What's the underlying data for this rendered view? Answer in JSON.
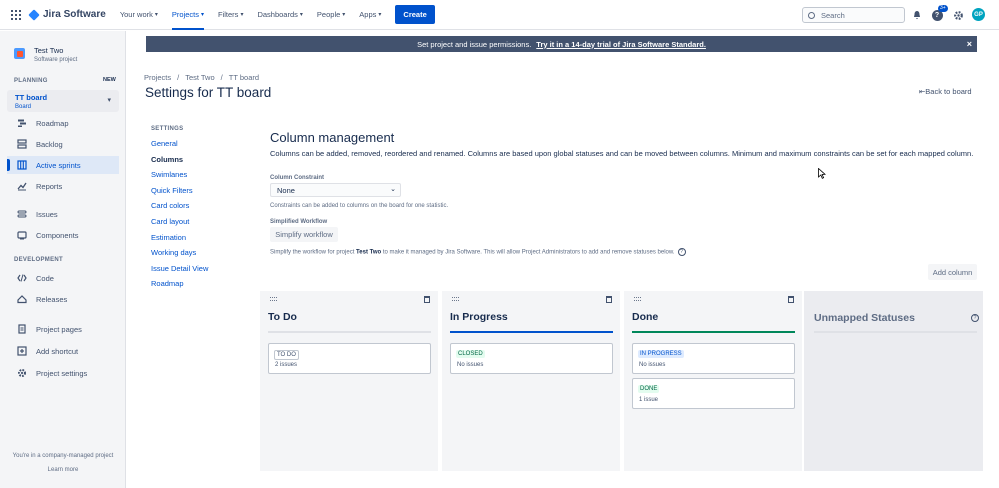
{
  "topnav": {
    "product": "Jira Software",
    "items": [
      {
        "label": "Your work",
        "active": false
      },
      {
        "label": "Projects",
        "active": true
      },
      {
        "label": "Filters",
        "active": false
      },
      {
        "label": "Dashboards",
        "active": false
      },
      {
        "label": "People",
        "active": false
      },
      {
        "label": "Apps",
        "active": false
      }
    ],
    "create": "Create",
    "search_placeholder": "Search",
    "help_badge": "3+",
    "avatar_initials": "GP"
  },
  "sidebar": {
    "project_name": "Test Two",
    "project_type": "Software project",
    "planning_label": "PLANNING",
    "new_badge": "NEW",
    "board_name": "TT board",
    "board_sub": "Board",
    "items": [
      {
        "label": "Roadmap",
        "icon": "roadmap-icon"
      },
      {
        "label": "Backlog",
        "icon": "backlog-icon"
      },
      {
        "label": "Active sprints",
        "icon": "board-icon",
        "active": true
      },
      {
        "label": "Reports",
        "icon": "reports-icon"
      },
      {
        "label": "Issues",
        "icon": "issues-icon"
      },
      {
        "label": "Components",
        "icon": "components-icon"
      }
    ],
    "dev_label": "DEVELOPMENT",
    "dev_items": [
      {
        "label": "Code",
        "icon": "code-icon"
      },
      {
        "label": "Releases",
        "icon": "releases-icon"
      }
    ],
    "bottom_items": [
      {
        "label": "Project pages",
        "icon": "pages-icon"
      },
      {
        "label": "Add shortcut",
        "icon": "add-shortcut-icon"
      },
      {
        "label": "Project settings",
        "icon": "gear-icon"
      }
    ],
    "footer": "You're in a company-managed project",
    "learn_more": "Learn more"
  },
  "banner": {
    "text": "Set project and issue permissions.",
    "link": "Try it in a 14-day trial of Jira Software Standard."
  },
  "breadcrumbs": [
    "Projects",
    "Test Two",
    "TT board"
  ],
  "page_title": "Settings for TT board",
  "back_link": "Back to board",
  "settings_nav": {
    "header": "SETTINGS",
    "items": [
      "General",
      "Columns",
      "Swimlanes",
      "Quick Filters",
      "Card colors",
      "Card layout",
      "Estimation",
      "Working days",
      "Issue Detail View",
      "Roadmap"
    ],
    "current": "Columns"
  },
  "column_mgmt": {
    "title": "Column management",
    "desc": "Columns can be added, removed, reordered and renamed. Columns are based upon global statuses and can be moved between columns. Minimum and maximum constraints can be set for each mapped column.",
    "constraint_label": "Column Constraint",
    "constraint_value": "None",
    "constraint_hint": "Constraints can be added to columns on the board for one statistic.",
    "simplified_label": "Simplified Workflow",
    "simplify_button": "Simplify workflow",
    "simplify_hint_pre": "Simplify the workflow for project",
    "simplify_hint_project": "Test Two",
    "simplify_hint_post": "to make it managed by Jira Software. This will allow Project Administrators to add and remove statuses below.",
    "add_column": "Add column"
  },
  "columns": [
    {
      "name": "To Do",
      "bar_color": "#dfe1e6",
      "statuses": [
        {
          "label": "TO DO",
          "kind": "gray",
          "count": "2 issues"
        }
      ]
    },
    {
      "name": "In Progress",
      "bar_color": "#0052cc",
      "statuses": [
        {
          "label": "CLOSED",
          "kind": "green",
          "count": "No issues"
        }
      ]
    },
    {
      "name": "Done",
      "bar_color": "#00875a",
      "statuses": [
        {
          "label": "IN PROGRESS",
          "kind": "blue",
          "count": "No issues"
        },
        {
          "label": "DONE",
          "kind": "green",
          "count": "1 issue"
        }
      ]
    }
  ],
  "unmapped": {
    "name": "Unmapped Statuses"
  }
}
